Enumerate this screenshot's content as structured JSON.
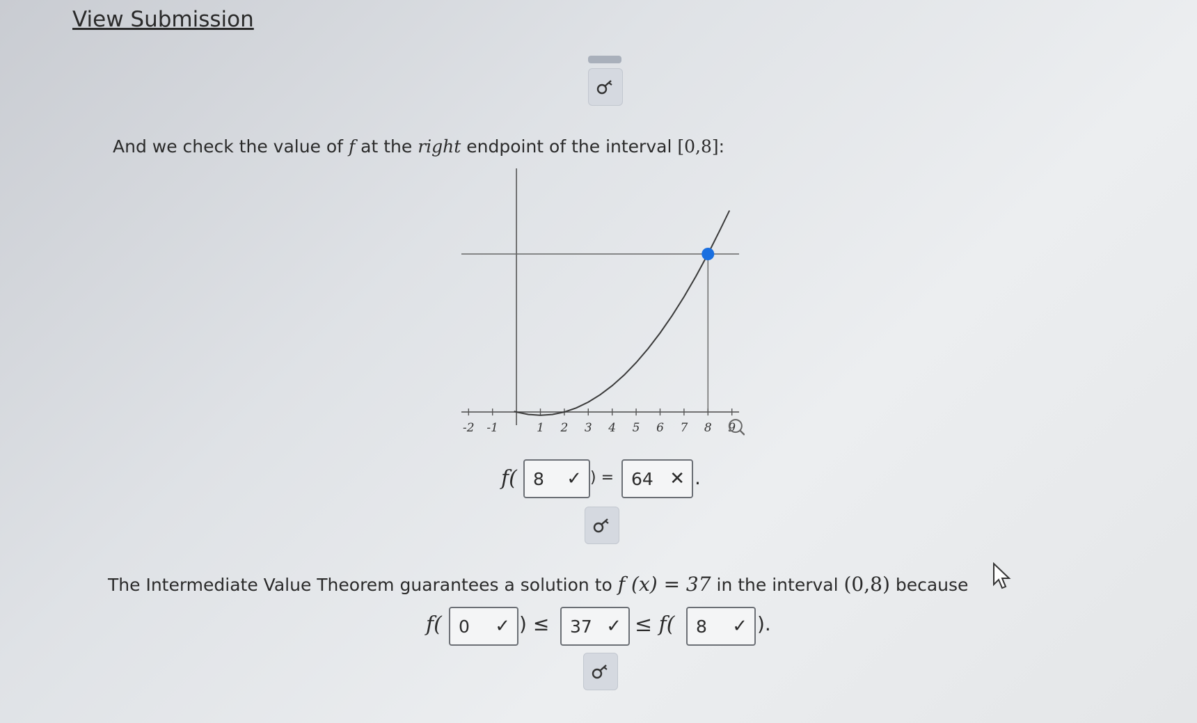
{
  "header": {
    "view_submission": "View Submission"
  },
  "line1": {
    "part1": "And we check the value of ",
    "f": "f",
    "part2": " at the ",
    "right": "right",
    "part3": " endpoint of the interval ",
    "interval": "[0,8]",
    "colon": ":"
  },
  "chart_data": {
    "type": "line",
    "function": "x^2 - 2x",
    "x_ticks": [
      "-2",
      "-1",
      "1",
      "2",
      "3",
      "4",
      "5",
      "6",
      "7",
      "8",
      "9"
    ],
    "xlim": [
      -2.3,
      9.3
    ],
    "ylim": [
      -4,
      74
    ],
    "points": [
      [
        -0.1,
        0.21
      ],
      [
        0,
        0
      ],
      [
        0.5,
        -0.75
      ],
      [
        1,
        -1
      ],
      [
        1.5,
        -0.75
      ],
      [
        2,
        0
      ],
      [
        2.5,
        1.25
      ],
      [
        3,
        3
      ],
      [
        3.5,
        5.25
      ],
      [
        4,
        8
      ],
      [
        4.5,
        11.25
      ],
      [
        5,
        15
      ],
      [
        5.5,
        19.25
      ],
      [
        6,
        24
      ],
      [
        6.5,
        29.25
      ],
      [
        7,
        35
      ],
      [
        7.5,
        41.25
      ],
      [
        8,
        48
      ],
      [
        8.5,
        55.25
      ],
      [
        8.9,
        61.21
      ]
    ],
    "highlight_point": [
      8,
      48
    ],
    "curve_color": "#3a3a3a",
    "point_color": "#1a6fe0",
    "axis_color": "#555555"
  },
  "eval1": {
    "f_label": "f(",
    "input_value": "8",
    "input_mark": "✓",
    "close_eq": ") =",
    "output_value": "64",
    "output_mark": "✕",
    "period": "."
  },
  "line2": {
    "part1": "The Intermediate Value Theorem guarantees a solution to ",
    "eq": "f (x) = 37",
    "part2": " in the interval ",
    "interval": "(0,8)",
    "part3": " because"
  },
  "ineq": {
    "f_open1": "f(",
    "box1_value": "0",
    "box1_mark": "✓",
    "close_le": ") ≤",
    "box2_value": "37",
    "box2_mark": "✓",
    "le_f_open": "≤ f(",
    "box3_value": "8",
    "box3_mark": "✓",
    "close_period": ")."
  },
  "icons": {
    "key": "key-icon",
    "cursor": "mouse-cursor-icon"
  }
}
